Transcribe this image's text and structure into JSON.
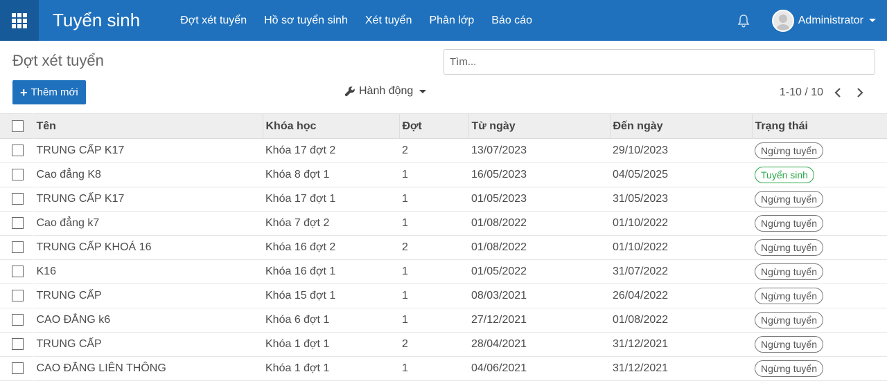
{
  "navbar": {
    "app_title": "Tuyển sinh",
    "menu": [
      "Đợt xét tuyển",
      "Hồ sơ tuyển sinh",
      "Xét tuyển",
      "Phân lớp",
      "Báo cáo"
    ],
    "user_name": "Administrator",
    "brand_color": "#1f71bd"
  },
  "control": {
    "title": "Đợt xét tuyển",
    "search_placeholder": "Tìm...",
    "create_label": "Thêm mới",
    "action_label": "Hành động",
    "pager_text": "1-10 / 10"
  },
  "table": {
    "headers": [
      "Tên",
      "Khóa học",
      "Đợt",
      "Từ ngày",
      "Đến ngày",
      "Trạng thái"
    ],
    "rows": [
      {
        "name": "TRUNG CẤP K17",
        "course": "Khóa 17 đợt 2",
        "round": "2",
        "from": "13/07/2023",
        "to": "29/10/2023",
        "status": "Ngừng tuyển",
        "active": false
      },
      {
        "name": "Cao đẳng K8",
        "course": "Khóa 8 đợt 1",
        "round": "1",
        "from": "16/05/2023",
        "to": "04/05/2025",
        "status": "Tuyển sinh",
        "active": true
      },
      {
        "name": "TRUNG CẤP K17",
        "course": "Khóa 17 đợt 1",
        "round": "1",
        "from": "01/05/2023",
        "to": "31/05/2023",
        "status": "Ngừng tuyển",
        "active": false
      },
      {
        "name": "Cao đẳng k7",
        "course": "Khóa 7 đợt 2",
        "round": "1",
        "from": "01/08/2022",
        "to": "01/10/2022",
        "status": "Ngừng tuyển",
        "active": false
      },
      {
        "name": "TRUNG CẤP KHOÁ 16",
        "course": "Khóa 16 đợt 2",
        "round": "2",
        "from": "01/08/2022",
        "to": "01/10/2022",
        "status": "Ngừng tuyển",
        "active": false
      },
      {
        "name": "K16",
        "course": "Khóa 16 đợt 1",
        "round": "1",
        "from": "01/05/2022",
        "to": "31/07/2022",
        "status": "Ngừng tuyển",
        "active": false
      },
      {
        "name": "TRUNG CẤP",
        "course": "Khóa 15 đợt 1",
        "round": "1",
        "from": "08/03/2021",
        "to": "26/04/2022",
        "status": "Ngừng tuyển",
        "active": false
      },
      {
        "name": "CAO ĐẲNG k6",
        "course": "Khóa 6 đợt 1",
        "round": "1",
        "from": "27/12/2021",
        "to": "01/08/2022",
        "status": "Ngừng tuyển",
        "active": false
      },
      {
        "name": "TRUNG CẤP",
        "course": "Khóa 1 đợt 1",
        "round": "2",
        "from": "28/04/2021",
        "to": "31/12/2021",
        "status": "Ngừng tuyển",
        "active": false
      },
      {
        "name": "CAO ĐẲNG LIÊN THÔNG",
        "course": "Khóa 1 đợt 1",
        "round": "1",
        "from": "04/06/2021",
        "to": "31/12/2021",
        "status": "Ngừng tuyển",
        "active": false
      }
    ]
  }
}
